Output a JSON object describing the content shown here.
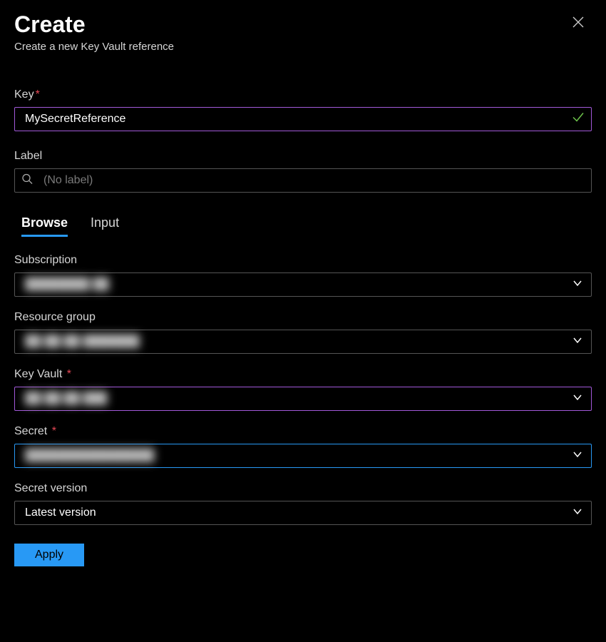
{
  "header": {
    "title": "Create",
    "subtitle": "Create a new Key Vault reference"
  },
  "fields": {
    "key": {
      "label": "Key",
      "required": true,
      "value": "MySecretReference"
    },
    "label": {
      "label": "Label",
      "placeholder": "(No label)",
      "value": ""
    }
  },
  "tabs": {
    "browse": "Browse",
    "input": "Input",
    "active": "browse"
  },
  "browse": {
    "subscription": {
      "label": "Subscription",
      "value": "████████ ██"
    },
    "resource_group": {
      "label": "Resource group",
      "value": "██ ██ ██ ███████"
    },
    "key_vault": {
      "label": "Key Vault",
      "required": true,
      "value": "██ ██ ██ ███"
    },
    "secret": {
      "label": "Secret",
      "required": true,
      "value": "████████████████"
    },
    "secret_version": {
      "label": "Secret version",
      "value": "Latest version"
    }
  },
  "buttons": {
    "apply": "Apply"
  }
}
